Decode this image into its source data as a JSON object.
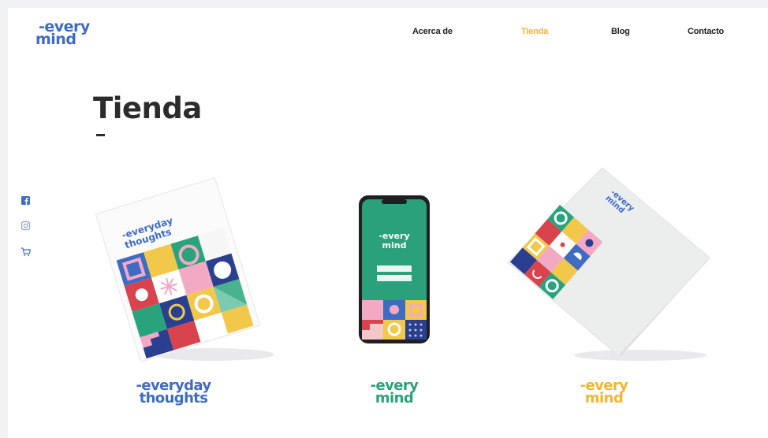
{
  "header": {
    "logo": {
      "line1": "-every",
      "line2": "mind"
    },
    "nav": [
      {
        "label": "Acerca de",
        "active": false
      },
      {
        "label": "Tienda",
        "active": true
      },
      {
        "label": "Blog",
        "active": false
      },
      {
        "label": "Contacto",
        "active": false
      }
    ]
  },
  "page": {
    "title": "Tienda",
    "title_mark": "-"
  },
  "social": [
    {
      "icon": "facebook-icon"
    },
    {
      "icon": "instagram-icon"
    },
    {
      "icon": "cart-icon"
    }
  ],
  "products": [
    {
      "name": "everyday-thoughts-notebook",
      "cover_text": {
        "line1": "-everyday",
        "line2": "thoughts"
      },
      "brand": {
        "line1": "-everyday",
        "line2": "thoughts"
      },
      "brand_color": "#3f6bc2"
    },
    {
      "name": "everymind-app",
      "screen_text": {
        "line1": "-every",
        "line2": "mind"
      },
      "brand": {
        "line1": "-every",
        "line2": "mind"
      },
      "brand_color": "#28a37c"
    },
    {
      "name": "everymind-box",
      "cover_text": {
        "line1": "-every",
        "line2": "mind"
      },
      "brand": {
        "line1": "-every",
        "line2": "mind"
      },
      "brand_color": "#f2b630"
    }
  ],
  "colors": {
    "accent_yellow": "#f2b630",
    "brand_blue": "#3f6bc2",
    "brand_green": "#28a37c",
    "pink": "#f3a9c4",
    "red": "#d9434e",
    "dark_green": "#2e8a55",
    "navy": "#2a3f8f"
  }
}
